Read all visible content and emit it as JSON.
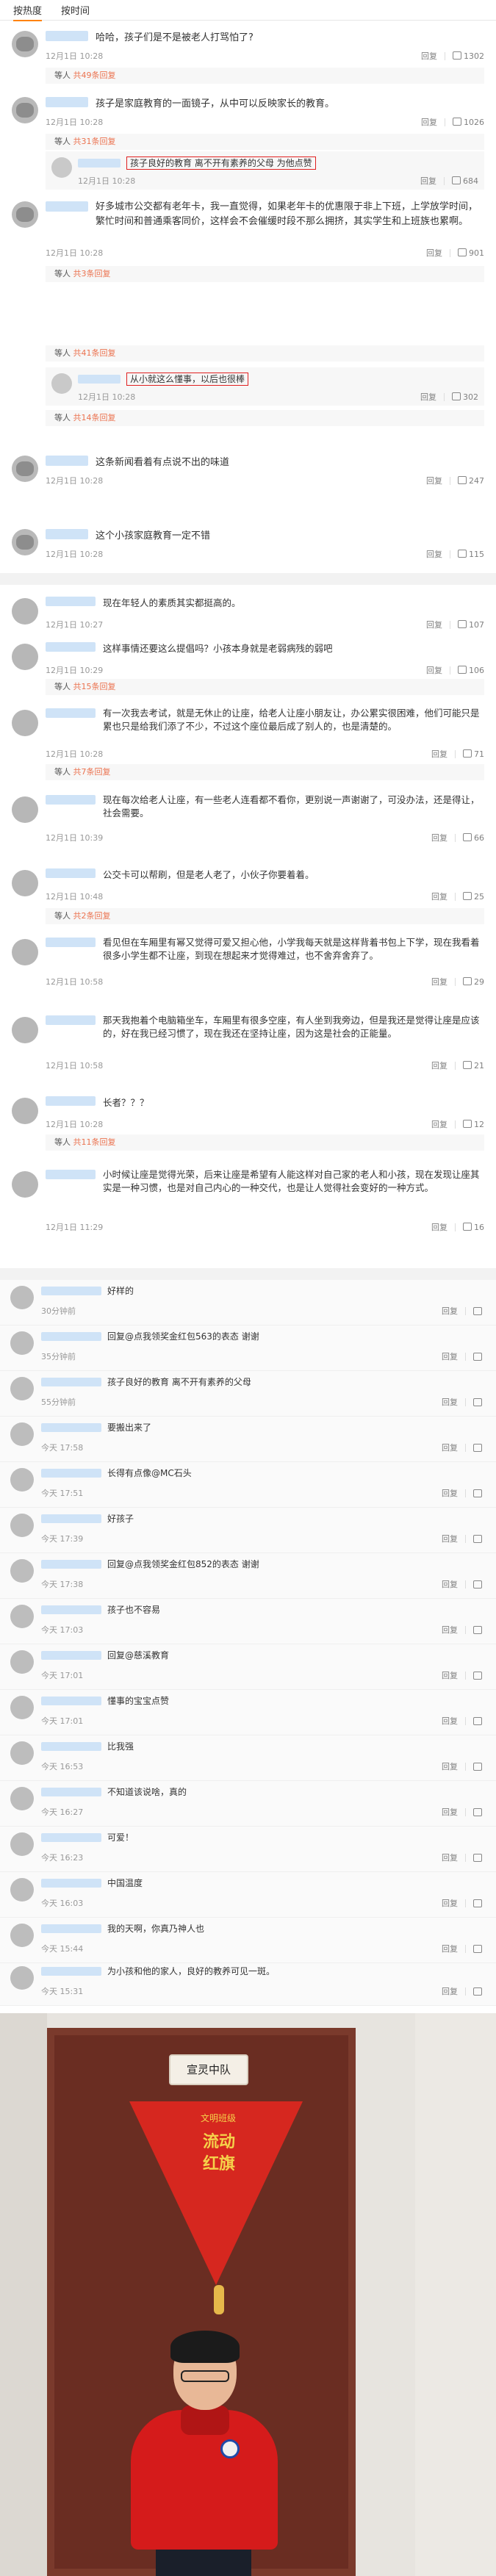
{
  "section1": {
    "tabs": [
      "按热度",
      "按时间"
    ],
    "comments": [
      {
        "text": "哈哈，孩子们是不是被老人打骂怕了?",
        "time": "12月1日 10:28",
        "reply_label": "回复",
        "likes": "1302"
      },
      {
        "text": "孩子是家庭教育的一面镜子，从中可以反映家长的教育。",
        "time": "12月1日 10:28",
        "reply_label": "回复",
        "likes": "1026"
      },
      {
        "text": "好多城市公交都有老年卡，我一直觉得，如果老年卡的优惠限于非上下班，上学放学时间，繁忙时间和普通乘客同价，这样会不会催缓时段不那么拥挤，其实学生和上班族也累啊。",
        "time": "12月1日 10:28",
        "reply_label": "回复",
        "likes": "901"
      },
      {
        "text": "这条新闻看着有点说不出的味道",
        "time": "12月1日 10:28",
        "reply_label": "回复",
        "likes": "247"
      },
      {
        "text": "这个小孩家庭教育一定不错",
        "time": "12月1日 10:28",
        "reply_label": "回复",
        "likes": "115"
      }
    ],
    "reply_bars": [
      {
        "prefix": "等人",
        "count": "共49条回复"
      },
      {
        "prefix": "等人",
        "count": "共31条回复"
      },
      {
        "prefix": "等人",
        "count": "共3条回复"
      },
      {
        "prefix": "等人",
        "count": "共41条回复"
      },
      {
        "prefix": "等人",
        "count": "共14条回复"
      }
    ],
    "replies": [
      {
        "text": "孩子良好的教育 离不开有素养的父母 为他点赞",
        "time": "12月1日 10:28",
        "reply_label": "回复",
        "likes": "684"
      },
      {
        "text": "从小就这么懂事，以后也很棒",
        "time": "12月1日 10:28",
        "reply_label": "回复",
        "likes": "302"
      }
    ]
  },
  "section2": {
    "comments": [
      {
        "line1": "现在年轻人的素质其实都挺高的。",
        "line2": "",
        "time": "12月1日 10:27",
        "reply_label": "回复",
        "likes": "107"
      },
      {
        "line1": "这样事情还要这么提倡吗？小孩本身就是老弱病残的弱吧",
        "line2": "",
        "time": "12月1日 10:29",
        "reply_label": "回复",
        "likes": "106"
      },
      {
        "line1": "有一次我去考试，就是无休止的让座，给老人让座小朋友让，办公累实很困难，他们可能只是累也只是给我们添了不少，不过这个座位最后成了别人的，也是清楚的。",
        "line2": "",
        "time": "12月1日 10:28",
        "reply_label": "回复",
        "likes": "71"
      },
      {
        "line1": "现在每次给老人让座，有一些老人连看都不看你，更别说一声谢谢了，可没办法，还是得让，社会需要。",
        "line2": "",
        "time": "12月1日 10:39",
        "reply_label": "回复",
        "likes": "66"
      },
      {
        "line1": "公交卡可以帮刷，但是老人老了，小伙子你要着着。",
        "line2": "",
        "time": "12月1日 10:48",
        "reply_label": "回复",
        "likes": "25"
      },
      {
        "line1": "看见但在车厢里有幂又觉得可爱又担心他，小学我每天就是这样背着书包上下学，现在我看着很多小学生都不让座，到现在想起来才觉得难过，也不舍弃舍弃了。",
        "line2": "",
        "time": "12月1日 10:58",
        "reply_label": "回复",
        "likes": "29"
      },
      {
        "line1": "那天我抱着个电脑箱坐车，车厢里有很多空座，有人坐到我旁边，但是我还是觉得让座是应该的，好在我已经习惯了，现在我还在坚持让座，因为这是社会的正能量。",
        "line2": "",
        "time": "12月1日 10:58",
        "reply_label": "回复",
        "likes": "21"
      },
      {
        "line1": "长者？？？",
        "line2": "",
        "time": "12月1日 10:28",
        "reply_label": "回复",
        "likes": "12"
      },
      {
        "line1": "小时候让座是觉得光荣，后来让座是希望有人能这样对自己家的老人和小孩，现在发现让座其实是一种习惯，也是对自己内心的一种交代，也是让人觉得社会变好的一种方式。",
        "line2": "",
        "time": "12月1日 11:29",
        "reply_label": "回复",
        "likes": "16"
      }
    ],
    "reply_bars": [
      {
        "prefix": "等人",
        "count": "共15条回复"
      },
      {
        "prefix": "等人",
        "count": "共7条回复"
      },
      {
        "prefix": "等人",
        "count": "共2条回复"
      },
      {
        "prefix": "等人",
        "count": "共11条回复"
      }
    ]
  },
  "section3": {
    "comments": [
      {
        "text": "好样的",
        "time": "30分钟前",
        "reply_label": "回复"
      },
      {
        "text": "回复@点我领奖金红包563的表态 谢谢",
        "time": "35分钟前",
        "reply_label": "回复"
      },
      {
        "text": "孩子良好的教育 离不开有素养的父母",
        "time": "55分钟前",
        "reply_label": "回复"
      },
      {
        "text": "要搬出来了",
        "time": "今天 17:58",
        "reply_label": "回复"
      },
      {
        "text": "长得有点像@MC石头",
        "time": "今天 17:51",
        "reply_label": "回复"
      },
      {
        "text": "好孩子",
        "time": "今天 17:39",
        "reply_label": "回复"
      },
      {
        "text": "回复@点我领奖金红包852的表态 谢谢",
        "time": "今天 17:38",
        "reply_label": "回复"
      },
      {
        "text": "孩子也不容易",
        "time": "今天 17:03",
        "reply_label": "回复"
      },
      {
        "text": "回复@慈溪教育",
        "time": "今天 17:01",
        "reply_label": "回复"
      },
      {
        "text": "懂事的宝宝点赞",
        "time": "今天 17:01",
        "reply_label": "回复"
      },
      {
        "text": "比我强",
        "time": "今天 16:53",
        "reply_label": "回复"
      },
      {
        "text": "不知道该说啥，真的",
        "time": "今天 16:27",
        "reply_label": "回复"
      },
      {
        "text": "可爱！",
        "time": "今天 16:23",
        "reply_label": "回复"
      },
      {
        "text": "中国温度",
        "time": "今天 16:03",
        "reply_label": "回复"
      },
      {
        "text": "我的天啊，你真乃神人也",
        "time": "今天 15:44",
        "reply_label": "回复"
      },
      {
        "text": "为小孩和他的家人，良好的教养可见一斑。",
        "time": "今天 15:31",
        "reply_label": "回复"
      }
    ]
  },
  "photo": {
    "sign": "宣灵中队",
    "pennant_small": "文明班级",
    "pennant_big": "流动红旗"
  }
}
